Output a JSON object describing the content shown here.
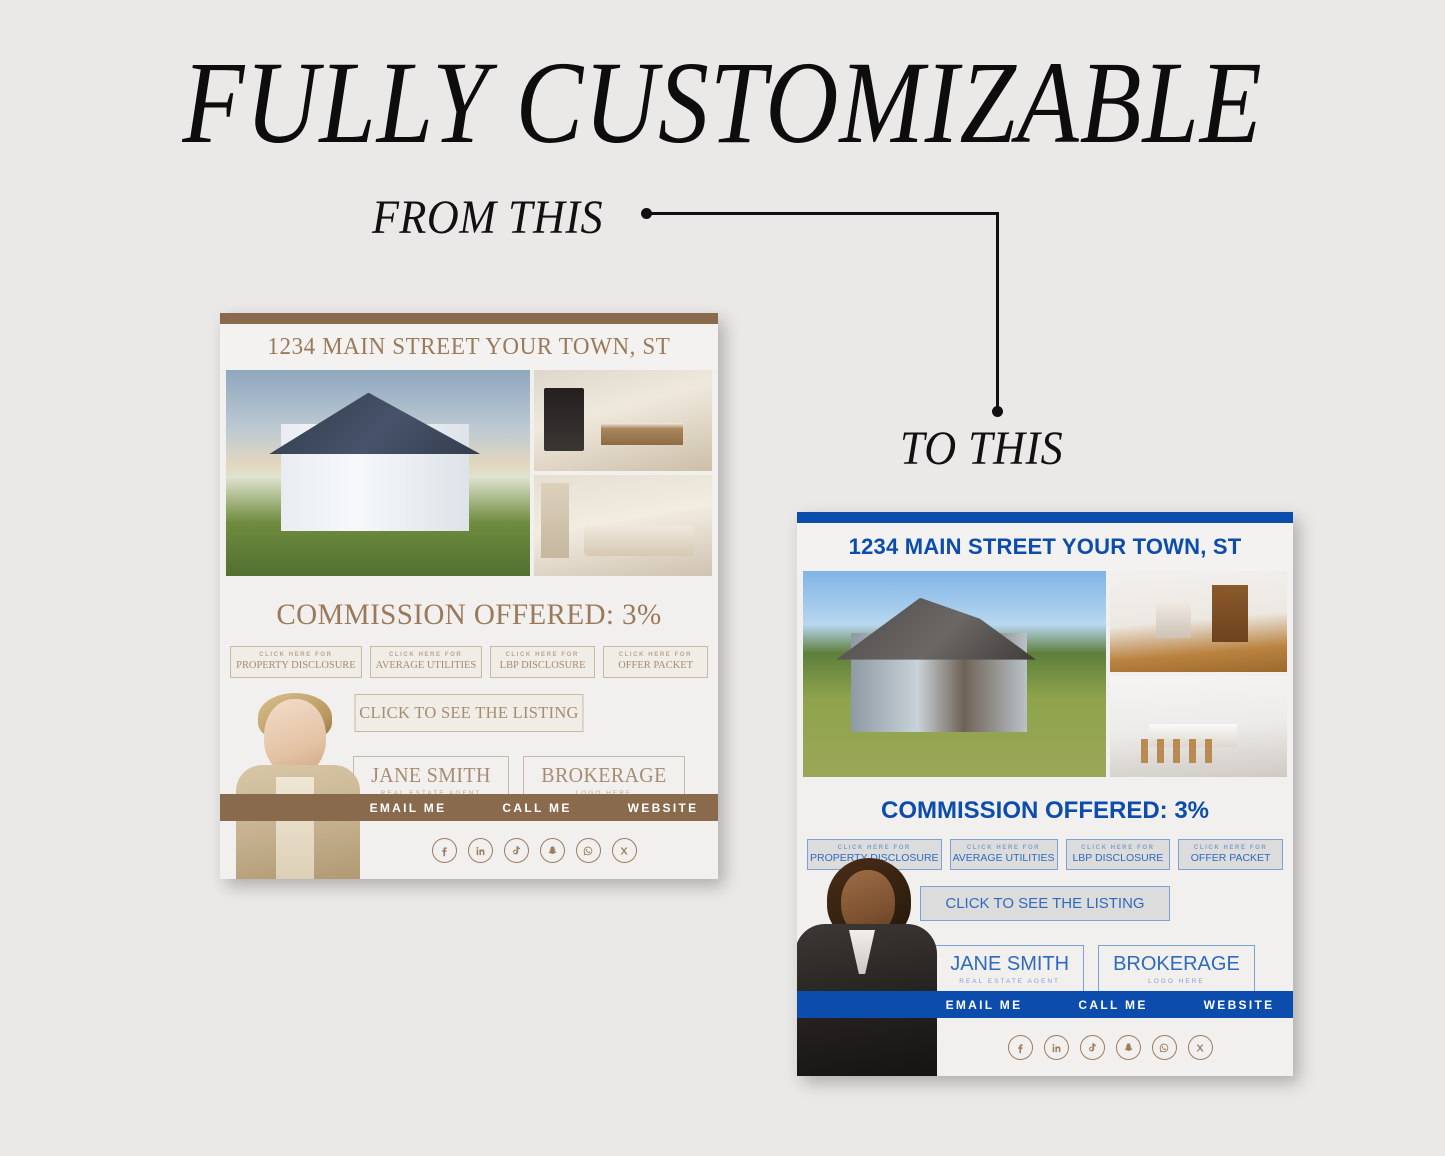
{
  "promo": {
    "title": "FULLY CUSTOMIZABLE",
    "from_label": "FROM THIS",
    "to_label": "TO THIS"
  },
  "colors": {
    "page_background": "#eae9e7",
    "brown_accent": "#8a6a4c",
    "brown_text": "#a58d72",
    "blue_accent": "#0b4cad",
    "blue_text": "#2f6bbd",
    "flyer_background": "#f2f0ee",
    "social_icon": "#9c7d5e"
  },
  "flyers": [
    {
      "id": "brown",
      "theme": "brown",
      "address": "1234 MAIN STREET YOUR TOWN, ST",
      "commission": "COMMISSION OFFERED: 3%",
      "doc_buttons": [
        {
          "kicker": "CLICK HERE FOR",
          "label": "PROPERTY DISCLOSURE"
        },
        {
          "kicker": "CLICK HERE FOR",
          "label": "AVERAGE UTILITIES"
        },
        {
          "kicker": "CLICK HERE FOR",
          "label": "LBP DISCLOSURE"
        },
        {
          "kicker": "CLICK HERE FOR",
          "label": "OFFER PACKET"
        }
      ],
      "listing_cta": "CLICK TO SEE THE LISTING",
      "agent_box": {
        "name": "JANE SMITH",
        "subtitle": "REAL ESTATE AGENT"
      },
      "brokerage_box": {
        "name": "BROKERAGE",
        "subtitle": "LOGO HERE"
      },
      "contact_links": [
        "EMAIL ME",
        "CALL ME",
        "WEBSITE"
      ],
      "social_icons": [
        "facebook-icon",
        "linkedin-icon",
        "tiktok-icon",
        "snapchat-icon",
        "whatsapp-icon",
        "x-twitter-icon"
      ],
      "photos": [
        "exterior-farmhouse-photo",
        "modern-kitchen-photo",
        "beige-living-room-photo"
      ]
    },
    {
      "id": "blue",
      "theme": "blue",
      "address": "1234 MAIN STREET YOUR TOWN, ST",
      "commission": "COMMISSION OFFERED: 3%",
      "doc_buttons": [
        {
          "kicker": "CLICK HERE FOR",
          "label": "PROPERTY DISCLOSURE"
        },
        {
          "kicker": "CLICK HERE FOR",
          "label": "AVERAGE UTILITIES"
        },
        {
          "kicker": "CLICK HERE FOR",
          "label": "LBP DISCLOSURE"
        },
        {
          "kicker": "CLICK HERE FOR",
          "label": "OFFER PACKET"
        }
      ],
      "listing_cta": "CLICK TO SEE THE LISTING",
      "agent_box": {
        "name": "JANE SMITH",
        "subtitle": "REAL ESTATE AGENT"
      },
      "brokerage_box": {
        "name": "BROKERAGE",
        "subtitle": "LOGO HERE"
      },
      "contact_links": [
        "EMAIL ME",
        "CALL ME",
        "WEBSITE"
      ],
      "social_icons": [
        "facebook-icon",
        "linkedin-icon",
        "tiktok-icon",
        "snapchat-icon",
        "whatsapp-icon",
        "x-twitter-icon"
      ],
      "photos": [
        "exterior-craftsman-photo",
        "living-room-fireplace-photo",
        "white-kitchen-photo"
      ]
    }
  ]
}
